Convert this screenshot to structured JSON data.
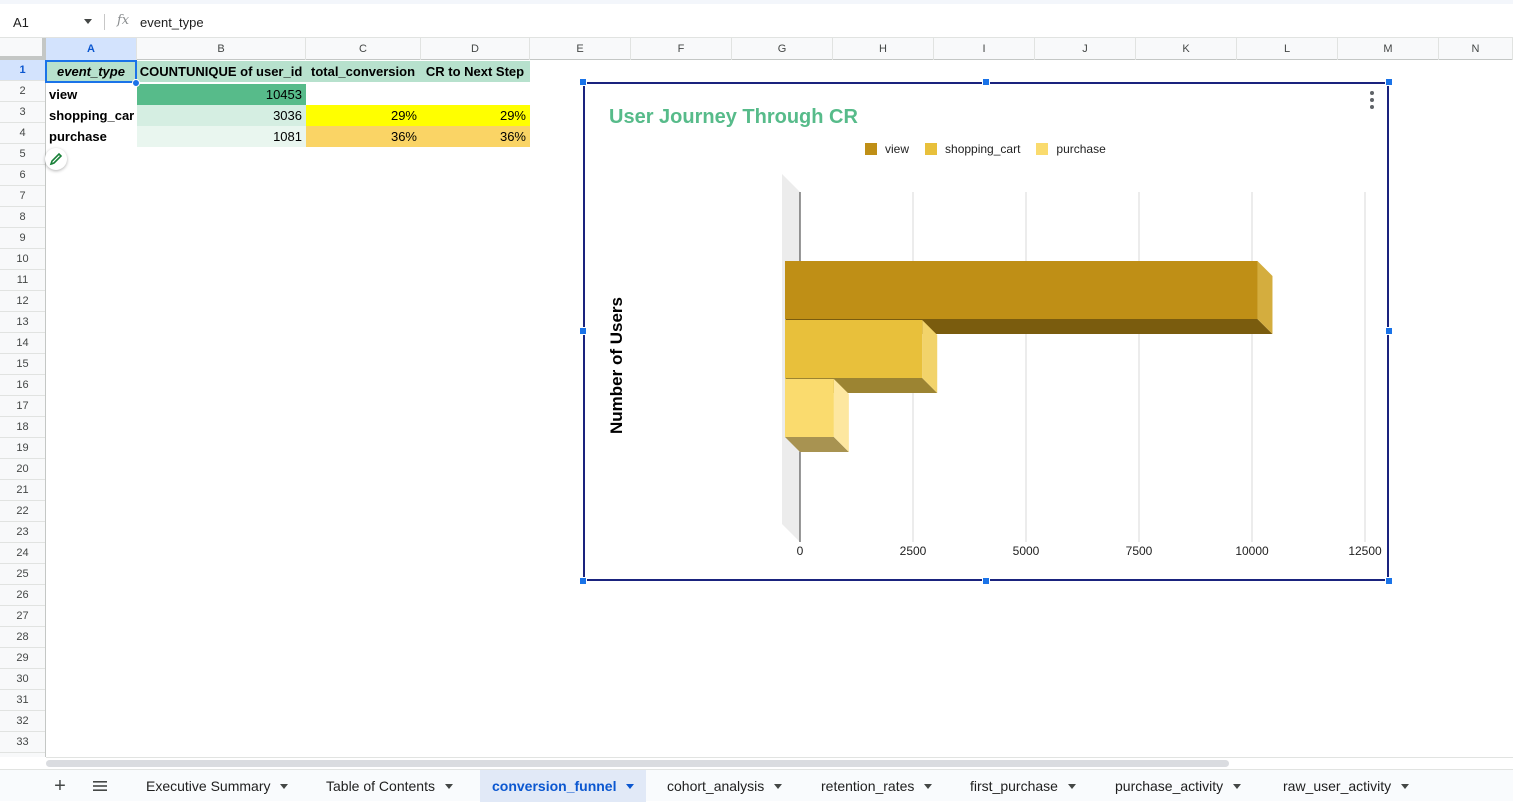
{
  "formula_bar": {
    "cell_ref": "A1",
    "fx_symbol": "fx",
    "value": "event_type"
  },
  "columns": [
    "A",
    "B",
    "C",
    "D",
    "E",
    "F",
    "G",
    "H",
    "I",
    "J",
    "K",
    "L",
    "M",
    "N"
  ],
  "rows": [
    "1",
    "2",
    "3",
    "4",
    "5",
    "6",
    "7",
    "8",
    "9",
    "10",
    "11",
    "12",
    "13",
    "14",
    "15",
    "16",
    "17",
    "18",
    "19",
    "20",
    "21",
    "22",
    "23",
    "24",
    "25",
    "26",
    "27",
    "28",
    "29",
    "30",
    "31",
    "32",
    "33"
  ],
  "table": {
    "headers": [
      "event_type",
      "COUNTUNIQUE of user_id",
      "total_conversion",
      "CR to Next Step"
    ],
    "rows": [
      {
        "event_type": "view",
        "count": "10453",
        "total_conversion": "",
        "cr_next": ""
      },
      {
        "event_type": "shopping_car",
        "count": "3036",
        "total_conversion": "29%",
        "cr_next": "29%"
      },
      {
        "event_type": "purchase",
        "count": "1081",
        "total_conversion": "36%",
        "cr_next": "36%"
      }
    ],
    "colors": {
      "header_bg": "#b7e1cd",
      "count_scale": [
        "#57bb8a",
        "#d5eee2",
        "#e9f6ef"
      ],
      "total_conversion": [
        "#ffff00",
        "#fad465"
      ],
      "cr_next": [
        "#ffff00",
        "#fad465"
      ]
    }
  },
  "chart": {
    "title": "User Journey Through CR",
    "ylabel": "Number of Users",
    "legend": [
      {
        "name": "view",
        "color": "#bf8f16"
      },
      {
        "name": "shopping_cart",
        "color": "#e8c03b"
      },
      {
        "name": "purchase",
        "color": "#fadb6e"
      }
    ],
    "x_ticks": [
      "0",
      "2500",
      "5000",
      "7500",
      "10000",
      "12500"
    ]
  },
  "chart_data": {
    "type": "bar",
    "title": "User Journey Through CR",
    "ylabel": "Number of Users",
    "xlabel": "",
    "orientation": "horizontal",
    "three_d": true,
    "xlim": [
      0,
      12500
    ],
    "series": [
      {
        "name": "view",
        "values": [
          10453
        ],
        "color": "#bf8f16"
      },
      {
        "name": "shopping_cart",
        "values": [
          3036
        ],
        "color": "#e8c03b"
      },
      {
        "name": "purchase",
        "values": [
          1081
        ],
        "color": "#fadb6e"
      }
    ],
    "grid": true,
    "legend_position": "top"
  },
  "sheet_tabs": [
    {
      "label": "Executive Summary",
      "active": false
    },
    {
      "label": "Table of Contents",
      "active": false
    },
    {
      "label": "conversion_funnel",
      "active": true
    },
    {
      "label": "cohort_analysis",
      "active": false
    },
    {
      "label": "retention_rates",
      "active": false
    },
    {
      "label": "first_purchase",
      "active": false
    },
    {
      "label": "purchase_activity",
      "active": false
    },
    {
      "label": "raw_user_activity",
      "active": false
    }
  ],
  "icons": {
    "add_sheet": "+",
    "all_sheets": "menu-icon",
    "edit": "pencil-icon"
  }
}
